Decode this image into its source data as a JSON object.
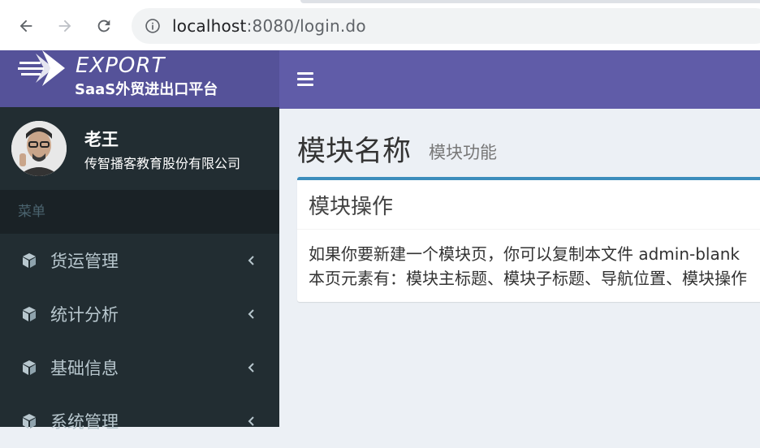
{
  "browser": {
    "url_host": "localhost",
    "url_rest": ":8080/login.do"
  },
  "brand": {
    "logo_text": "EXPORT",
    "subtitle": "SaaS外贸进出口平台",
    "colors": {
      "logo_bg": "#555299",
      "topnav_bg": "#605ca8",
      "sidebar_bg": "#222d32",
      "box_accent": "#3c8dbc"
    }
  },
  "user": {
    "name": "老王",
    "org": "传智播客教育股份有限公司"
  },
  "sidebar": {
    "header": "菜单",
    "items": [
      {
        "label": "货运管理",
        "icon": "cube-icon"
      },
      {
        "label": "统计分析",
        "icon": "cube-icon"
      },
      {
        "label": "基础信息",
        "icon": "cube-icon"
      },
      {
        "label": "系统管理",
        "icon": "cube-icon"
      }
    ]
  },
  "main": {
    "title": "模块名称",
    "subtitle": "模块功能",
    "box": {
      "title": "模块操作",
      "line1": "如果你要新建一个模块页，你可以复制本文件 admin-blank",
      "line2": "本页元素有：模块主标题、模块子标题、导航位置、模块操作"
    }
  }
}
